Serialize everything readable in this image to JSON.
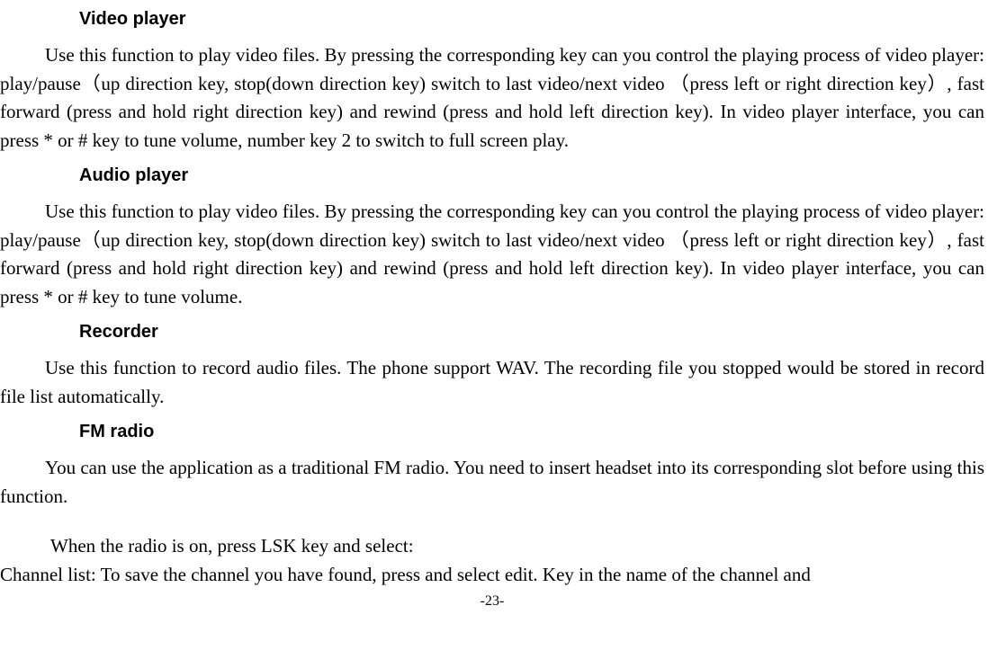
{
  "sections": {
    "video_player": {
      "heading": "Video player",
      "body": "Use this function to play video files. By pressing the corresponding key can you control the playing process of video player: play/pause（up direction key, stop(down direction key) switch to last video/next video （press left or right direction key）, fast forward (press and hold right direction key) and rewind (press and hold left direction key). In video player interface, you can press * or # key to tune volume, number key 2 to switch to full screen play."
    },
    "audio_player": {
      "heading": "Audio player",
      "body": "Use this function to play video files. By pressing the corresponding key can you control the playing process of video player: play/pause（up direction key, stop(down direction key) switch to last video/next video （press left or right direction key）, fast forward (press and hold right direction key) and rewind (press and hold left direction key). In video player interface, you can press * or # key to tune volume."
    },
    "recorder": {
      "heading": "Recorder",
      "body": "Use this function to record audio files. The phone support WAV. The recording file you stopped would be stored in record file list automatically."
    },
    "fm_radio": {
      "heading": "FM radio",
      "body1": "You can use the application as a traditional FM radio. You need to insert headset into its corresponding slot before using this function.",
      "body2": "When the radio is on, press LSK key and select:",
      "body3": "Channel list: To save the channel you have found, press and select edit. Key in the name of the channel and"
    }
  },
  "page_number": "-23-"
}
